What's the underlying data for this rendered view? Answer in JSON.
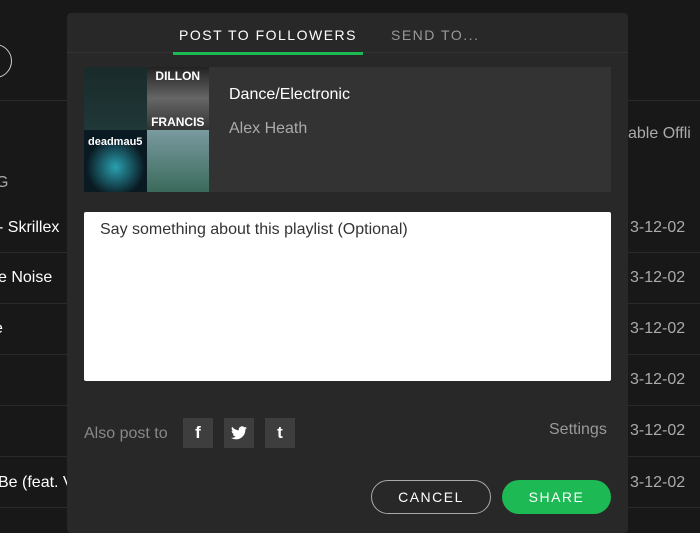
{
  "background": {
    "left_rows": [
      "G",
      "- Skrillex",
      "e Noise",
      "e",
      "Be (feat. V"
    ],
    "right_header": "able Offli",
    "dates": [
      "3-12-02",
      "3-12-02",
      "3-12-02",
      "3-12-02",
      "3-12-02",
      "3-12-02"
    ]
  },
  "tabs": [
    {
      "label": "POST TO FOLLOWERS",
      "active": true
    },
    {
      "label": "SEND TO...",
      "active": false
    }
  ],
  "playlist": {
    "title": "Dance/Electronic",
    "owner": "Alex Heath",
    "art_text": [
      "DILLON",
      "FRANCIS",
      "deadmau5"
    ]
  },
  "message": {
    "value": "",
    "placeholder": "Say something about this playlist (Optional)"
  },
  "also_post": {
    "label": "Also post to",
    "services": [
      {
        "name": "facebook",
        "glyph": "f"
      },
      {
        "name": "twitter",
        "glyph": "t-bird"
      },
      {
        "name": "tumblr",
        "glyph": "t"
      }
    ]
  },
  "settings_label": "Settings",
  "buttons": {
    "cancel": "CANCEL",
    "share": "SHARE"
  },
  "colors": {
    "accent": "#1db954",
    "modal": "#282828"
  }
}
